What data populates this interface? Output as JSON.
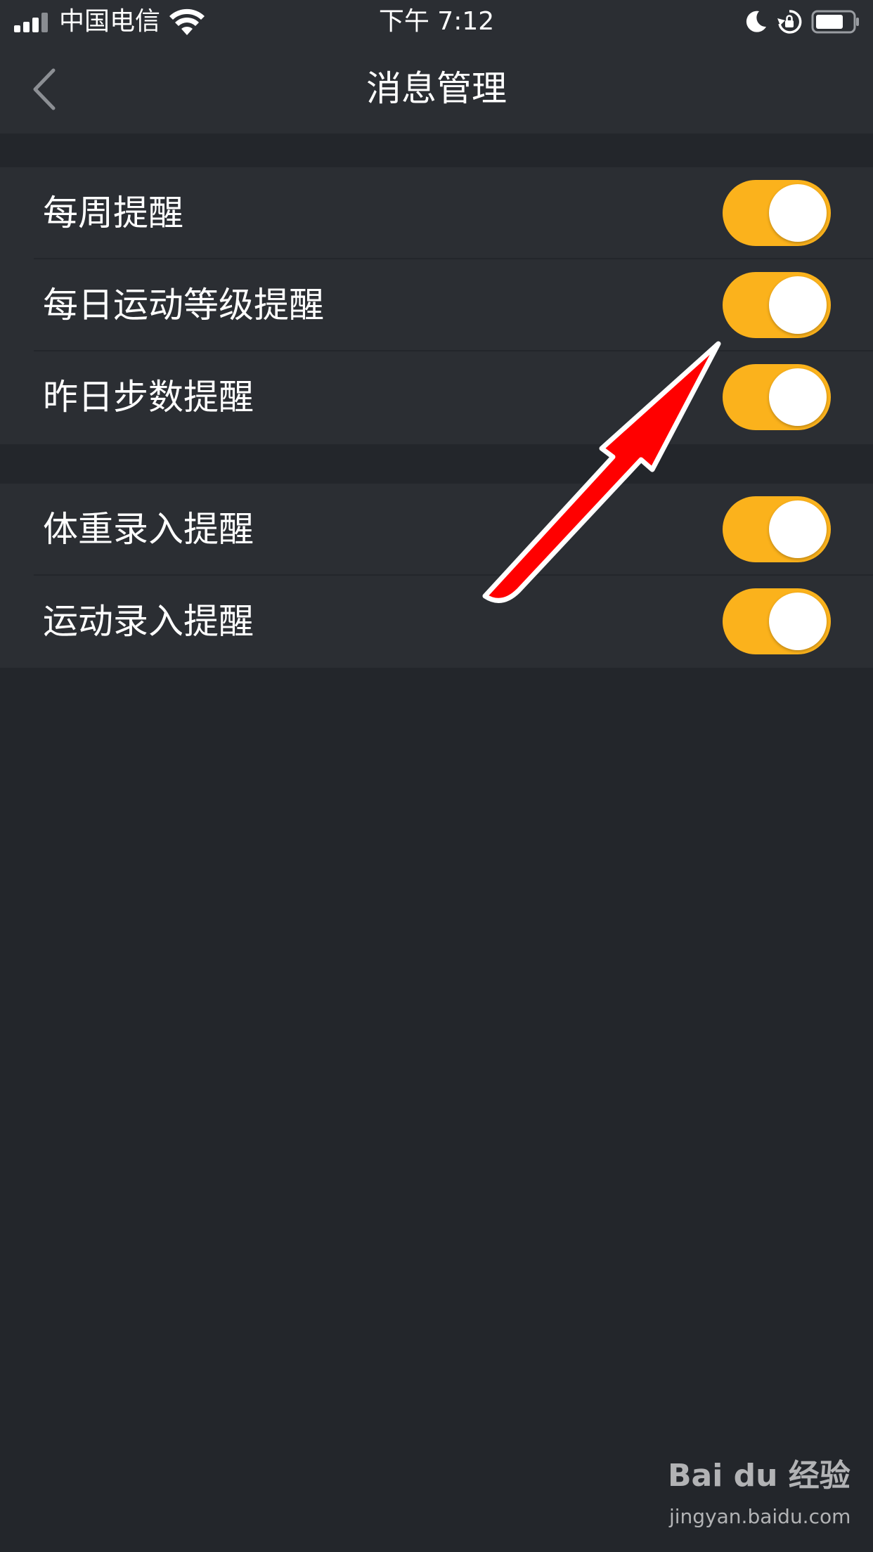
{
  "status_bar": {
    "carrier": "中国电信",
    "time": "下午 7:12"
  },
  "nav": {
    "title": "消息管理"
  },
  "groups": [
    {
      "items": [
        {
          "label": "每周提醒",
          "on": true
        },
        {
          "label": "每日运动等级提醒",
          "on": true
        },
        {
          "label": "昨日步数提醒",
          "on": true
        }
      ]
    },
    {
      "items": [
        {
          "label": "体重录入提醒",
          "on": true
        },
        {
          "label": "运动录入提醒",
          "on": true
        }
      ]
    }
  ],
  "colors": {
    "background": "#23262b",
    "panel": "#2b2e33",
    "toggle_on": "#fbb21c",
    "annotation_arrow": "#ff0000"
  },
  "watermark": {
    "logo": "Bai du 经验",
    "url": "jingyan.baidu.com"
  }
}
